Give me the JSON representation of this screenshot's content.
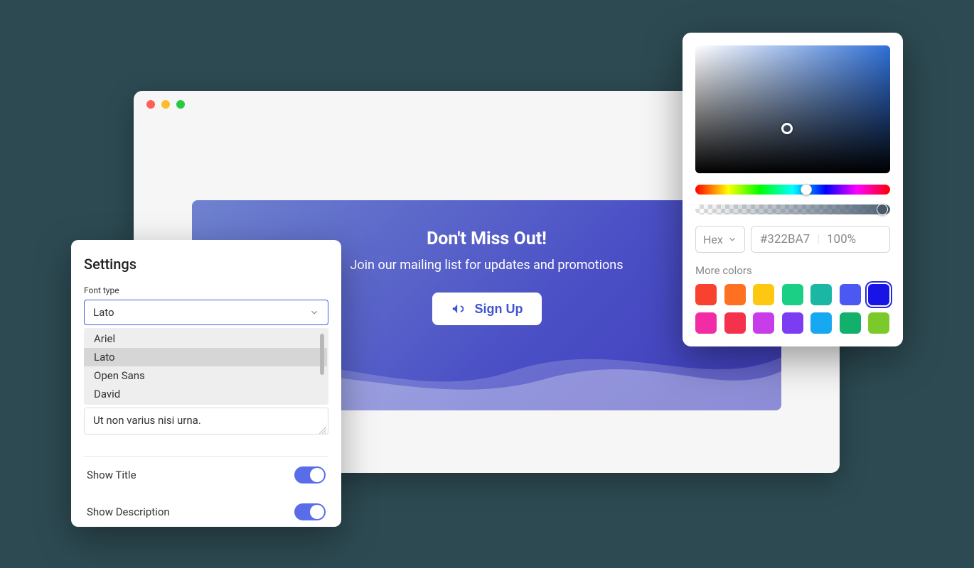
{
  "hero": {
    "title": "Don't Miss Out!",
    "subtitle": "Join our mailing list for updates and promotions",
    "cta": "Sign Up"
  },
  "settings": {
    "title": "Settings",
    "font_type_label": "Font type",
    "font_selected": "Lato",
    "font_options": [
      "Ariel",
      "Lato",
      "Open Sans",
      "David"
    ],
    "placeholder_text": "Ut non varius nisi urna.",
    "show_title_label": "Show Title",
    "show_title": true,
    "show_description_label": "Show Description",
    "show_description": true
  },
  "picker": {
    "format_label": "Hex",
    "hex": "#322BA7",
    "opacity": "100%",
    "more_label": "More colors",
    "swatches": [
      {
        "hex": "#F8412F",
        "active": false
      },
      {
        "hex": "#FE7122",
        "active": false
      },
      {
        "hex": "#FEC710",
        "active": false
      },
      {
        "hex": "#1BCF84",
        "active": false
      },
      {
        "hex": "#1BB7A5",
        "active": false
      },
      {
        "hex": "#4C58F2",
        "active": false
      },
      {
        "hex": "#1914E6",
        "active": true
      },
      {
        "hex": "#F22CA5",
        "active": false
      },
      {
        "hex": "#F5324E",
        "active": false
      },
      {
        "hex": "#C83CEA",
        "active": false
      },
      {
        "hex": "#7C3CF2",
        "active": false
      },
      {
        "hex": "#17A8F2",
        "active": false
      },
      {
        "hex": "#12B06A",
        "active": false
      },
      {
        "hex": "#7CC92B",
        "active": false
      }
    ]
  }
}
